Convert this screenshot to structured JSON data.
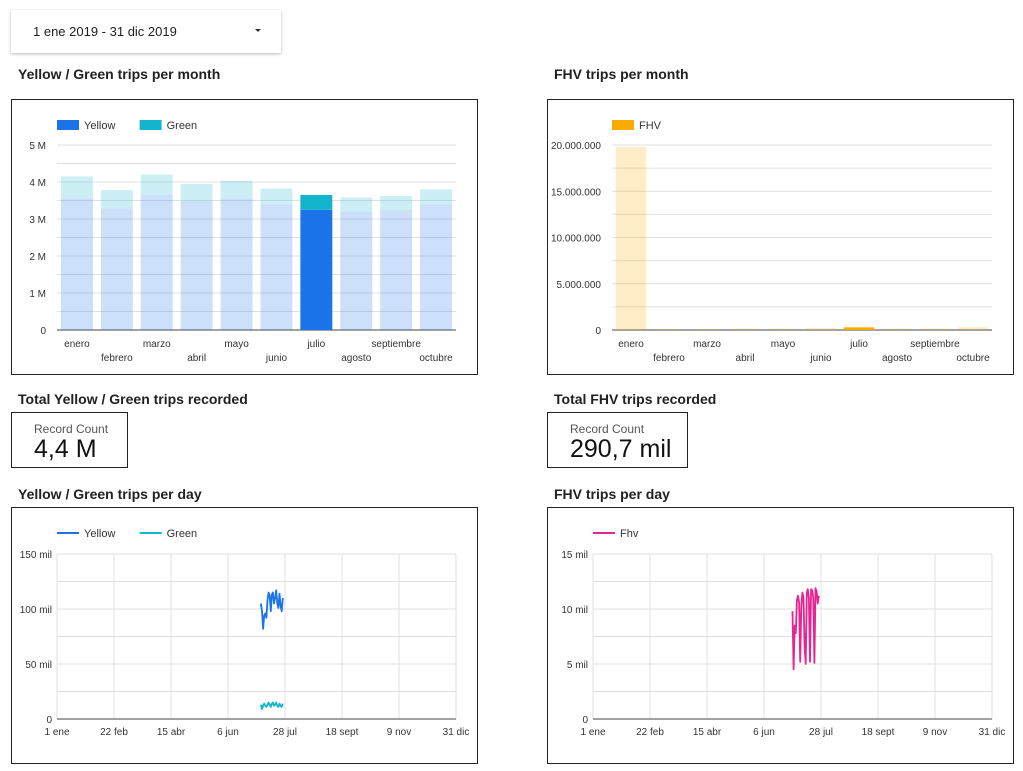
{
  "date_range": {
    "label": "1 ene 2019 - 31 dic 2019"
  },
  "titles": {
    "yg_month": "Yellow / Green trips per month",
    "fhv_month": "FHV trips per month",
    "yg_total": "Total Yellow / Green trips recorded",
    "fhv_total": "Total FHV trips recorded",
    "yg_day": "Yellow / Green trips per day",
    "fhv_day": "FHV trips per day"
  },
  "scorecards": {
    "yg": {
      "label": "Record Count",
      "value": "4,4 M"
    },
    "fhv": {
      "label": "Record Count",
      "value": "290,7 mil"
    }
  },
  "colors": {
    "yellow": "#1a73e8",
    "green": "#12b5cb",
    "fhv": "#f9ab00",
    "fhv_line": "#e52592",
    "grid": "#e0e0e0",
    "axis": "#444444"
  },
  "chart_data": [
    {
      "type": "bar",
      "stacked": true,
      "categories": [
        "enero",
        "febrero",
        "marzo",
        "abril",
        "mayo",
        "junio",
        "julio",
        "agosto",
        "septiembre",
        "octubre"
      ],
      "series": [
        {
          "name": "Yellow",
          "values": [
            3.55,
            3.28,
            3.65,
            3.48,
            3.55,
            3.4,
            3.25,
            3.2,
            3.25,
            3.4
          ]
        },
        {
          "name": "Green",
          "values": [
            0.6,
            0.5,
            0.55,
            0.47,
            0.48,
            0.42,
            0.4,
            0.38,
            0.37,
            0.4
          ]
        }
      ],
      "highlighted_category": "julio",
      "yticks": [
        "0",
        "1 M",
        "2 M",
        "3 M",
        "4 M",
        "5 M"
      ],
      "ylim": [
        0,
        5
      ],
      "legend": "top-left",
      "grid": true
    },
    {
      "type": "bar",
      "categories": [
        "enero",
        "febrero",
        "marzo",
        "abril",
        "mayo",
        "junio",
        "julio",
        "agosto",
        "septiembre",
        "octubre"
      ],
      "series": [
        {
          "name": "FHV",
          "values": [
            19800000,
            100000,
            100000,
            150000,
            150000,
            200000,
            290700,
            150000,
            150000,
            300000
          ]
        }
      ],
      "highlighted_category": "julio",
      "yticks": [
        "0",
        "5.000.000",
        "10.000.000",
        "15.000.000",
        "20.000.000"
      ],
      "ylim": [
        0,
        20000000
      ],
      "legend": "top-left",
      "grid": true
    },
    {
      "type": "line",
      "xticks": [
        "1 ene",
        "22 feb",
        "15 abr",
        "6 jun",
        "28 jul",
        "18 sept",
        "9 nov",
        "31 dic"
      ],
      "yticks": [
        "0",
        "50 mil",
        "100 mil",
        "150 mil"
      ],
      "ylim": [
        0,
        150
      ],
      "legend": "top-left",
      "grid": true,
      "series": [
        {
          "name": "Yellow",
          "start_day": 186,
          "values": [
            105,
            98,
            82,
            94,
            96,
            92,
            108,
            115,
            112,
            98,
            113,
            115,
            105,
            110,
            117,
            105,
            101,
            114,
            103,
            98,
            110
          ]
        },
        {
          "name": "Green",
          "start_day": 186,
          "values": [
            13,
            9,
            12,
            14,
            12,
            11,
            13,
            15,
            13,
            11,
            14,
            15,
            12,
            13,
            15,
            12,
            11,
            14,
            12,
            11,
            14
          ]
        }
      ]
    },
    {
      "type": "line",
      "xticks": [
        "1 ene",
        "22 feb",
        "15 abr",
        "6 jun",
        "28 jul",
        "18 sept",
        "9 nov",
        "31 dic"
      ],
      "yticks": [
        "0",
        "5 mil",
        "10 mil",
        "15 mil"
      ],
      "ylim": [
        0,
        15
      ],
      "legend": "top-left",
      "grid": true,
      "series": [
        {
          "name": "Fhv",
          "start_day": 182,
          "values": [
            9.8,
            4.5,
            8.5,
            7.8,
            10.8,
            11.2,
            10.6,
            5.2,
            10.2,
            11.5,
            11,
            6.5,
            5,
            11.5,
            11.8,
            11,
            5.2,
            11.8,
            11.7,
            11,
            5.1,
            11.9,
            11.6,
            10.5,
            11.2
          ]
        }
      ]
    }
  ]
}
